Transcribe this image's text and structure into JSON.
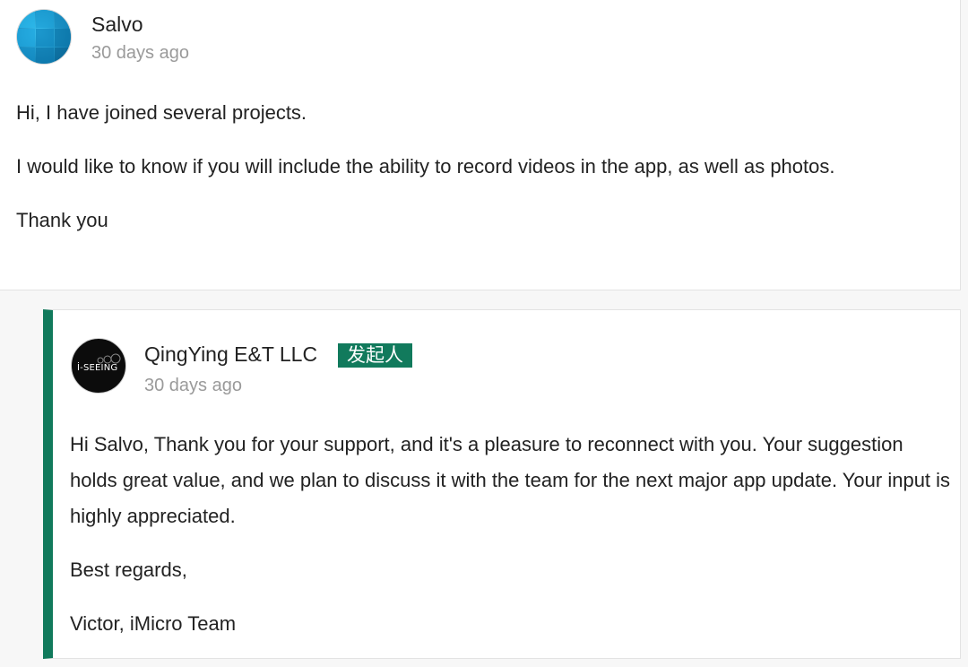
{
  "comment": {
    "author": "Salvo",
    "time": "30 days ago",
    "avatar_color": "#1aa3d9",
    "paragraphs": [
      "Hi, I have joined several projects.",
      "I would like to know if you will include the ability to record videos in the app, as well as photos.",
      "Thank you"
    ]
  },
  "reply": {
    "author": "QingYing E&T LLC",
    "badge": "发起人",
    "time": "30 days ago",
    "avatar_logo_text": "İ-SEEING",
    "accent_color": "#117a5c",
    "paragraphs": [
      "Hi Salvo, Thank you for your support, and it's a pleasure to reconnect with you. Your suggestion holds great value, and we plan to discuss it with the team for the next major app update. Your input is highly appreciated.",
      "Best regards,",
      "Victor, iMicro Team"
    ]
  }
}
